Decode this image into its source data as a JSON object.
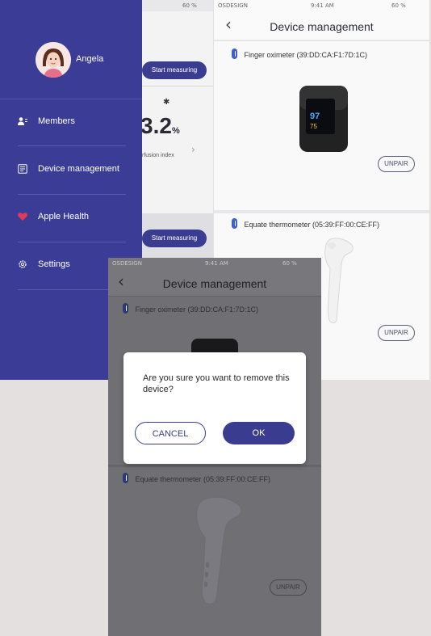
{
  "colors": {
    "accent": "#3a3d8f",
    "sidebar": "#3a3c96",
    "bluetooth": "#3e5ecf"
  },
  "back_home": {
    "status": {
      "battery": "60 %"
    },
    "start_measuring_top": "Start measuring",
    "start_measuring_bottom": "Start measuring",
    "value": "3.2",
    "unit": "%",
    "value_label": "rfusion index"
  },
  "sidebar": {
    "user_name": "Angela",
    "items": [
      {
        "label": "Members",
        "icon": "members-icon"
      },
      {
        "label": "Device management",
        "icon": "device-icon"
      },
      {
        "label": "Apple Health",
        "icon": "heart-icon"
      },
      {
        "label": "Settings",
        "icon": "gear-icon"
      }
    ]
  },
  "right_screen": {
    "status": {
      "carrier": "OSDESIGN",
      "time": "9:41 AM",
      "battery": "60 %"
    },
    "title": "Device management",
    "devices": [
      {
        "name": "Finger oximeter (39:DD:CA:F1:7D:1C)",
        "action": "UNPAIR"
      },
      {
        "name": "Equate thermometer (05:39:FF:00:CE:FF)",
        "action": "UNPAIR"
      }
    ],
    "oximeter_display": {
      "spo2": "97",
      "pr": "75"
    }
  },
  "front_screen": {
    "status": {
      "carrier": "OSDESIGN",
      "time": "9:41 AM",
      "battery": "60 %"
    },
    "title": "Device management",
    "devices": [
      {
        "name": "Finger oximeter (39:DD:CA:F1:7D:1C)"
      },
      {
        "name": "Equate thermometer (05:39:FF:00:CE:FF)",
        "action": "UNPAIR"
      }
    ],
    "dialog": {
      "message": "Are you sure you want to remove this device?",
      "cancel": "CANCEL",
      "ok": "OK"
    }
  }
}
